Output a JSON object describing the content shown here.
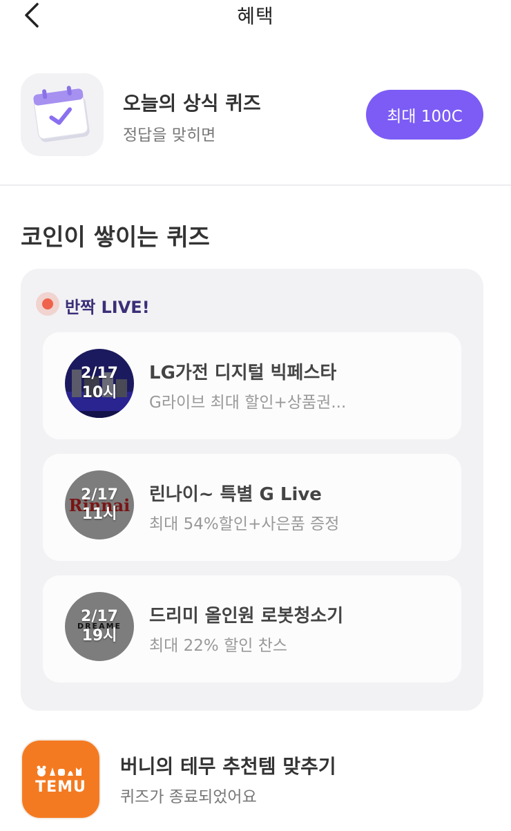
{
  "header": {
    "title": "혜택",
    "back_icon": "chevron-left-icon"
  },
  "daily_quiz": {
    "title": "오늘의 상식 퀴즈",
    "subtitle": "정답을 맞히면",
    "reward_label": "최대 100C",
    "icon": "calendar-check-icon"
  },
  "section": {
    "title": "코인이 쌓이는 퀴즈"
  },
  "live": {
    "label": "반짝 LIVE!",
    "accent": "#ef634c",
    "events": [
      {
        "date": "2/17",
        "time": "10시",
        "title": "LG가전 디지털 빅페스타",
        "subtitle": "G라이브 최대 할인+상품권..."
      },
      {
        "date": "2/17",
        "time": "11시",
        "brand": "Rinnai",
        "title": "린나이~ 특별 G Live",
        "subtitle": "최대 54%할인+사은품 증정"
      },
      {
        "date": "2/17",
        "time": "19시",
        "brand": "DREAME",
        "title": "드리미 올인원 로봇청소기",
        "subtitle": "최대 22% 할인 찬스"
      }
    ]
  },
  "temu_quiz": {
    "logo_text": "TEMU",
    "title": "버니의 테무 추천템 맞추기",
    "subtitle": "퀴즈가 종료되었어요",
    "brand_color": "#f47a21"
  },
  "colors": {
    "primary": "#7c5cf5",
    "live_label": "#3b2f78",
    "panel_bg": "#f2f2f4"
  }
}
